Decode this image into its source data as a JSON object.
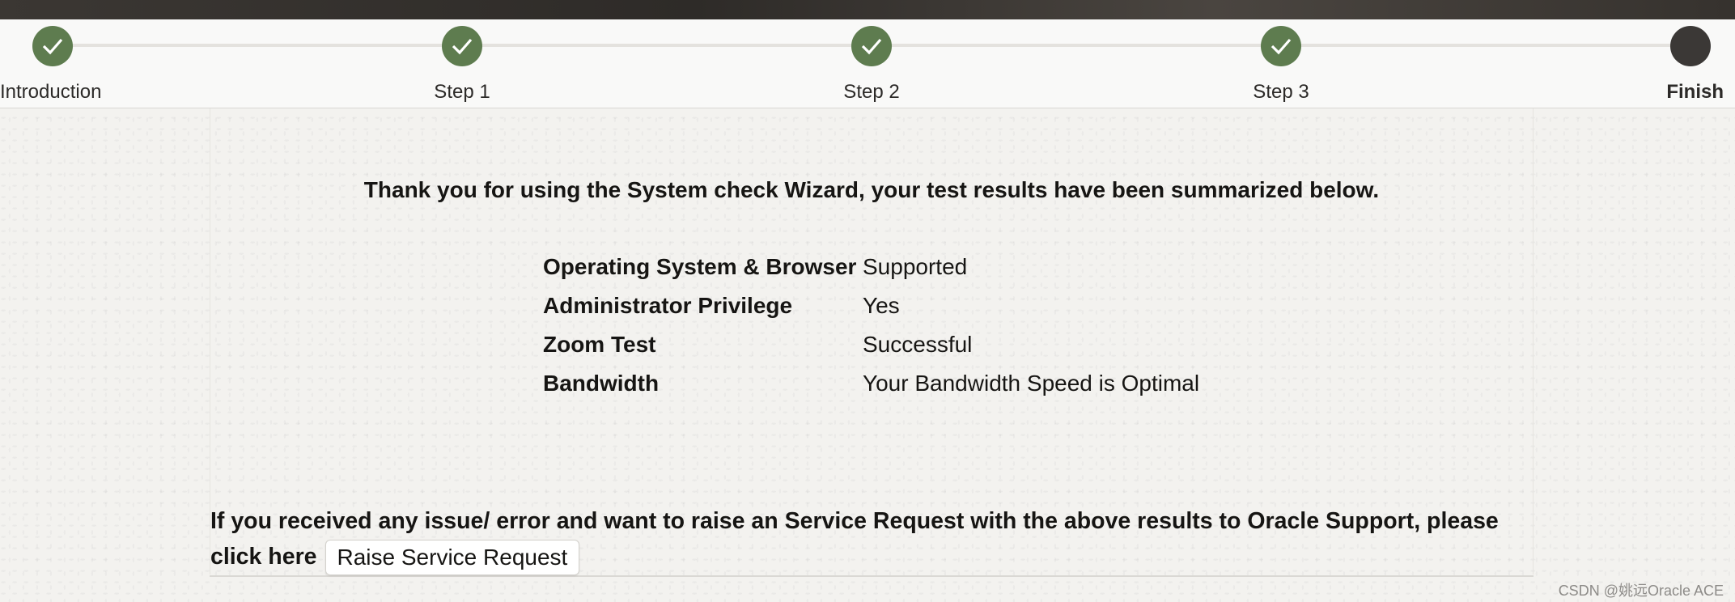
{
  "train": {
    "steps": [
      {
        "label": "Introduction",
        "status": "completed"
      },
      {
        "label": "Step 1",
        "status": "completed"
      },
      {
        "label": "Step 2",
        "status": "completed"
      },
      {
        "label": "Step 3",
        "status": "completed"
      },
      {
        "label": "Finish",
        "status": "current"
      }
    ],
    "colors": {
      "completed": "#5e7c4f",
      "current": "#3b3836"
    }
  },
  "summary": {
    "intro": "Thank you for using the System check Wizard, your test results have been summarized below.",
    "results": [
      {
        "label": "Operating System & Browser",
        "value": "Supported"
      },
      {
        "label": "Administrator Privilege",
        "value": "Yes"
      },
      {
        "label": "Zoom Test",
        "value": "Successful"
      },
      {
        "label": "Bandwidth",
        "value": "Your Bandwidth Speed is Optimal"
      }
    ]
  },
  "footer": {
    "text": "If you received any issue/ error and want to raise an Service Request with the above results to Oracle Support, please click here",
    "button_label": "Raise Service Request"
  },
  "watermark": "CSDN @姚远Oracle ACE"
}
